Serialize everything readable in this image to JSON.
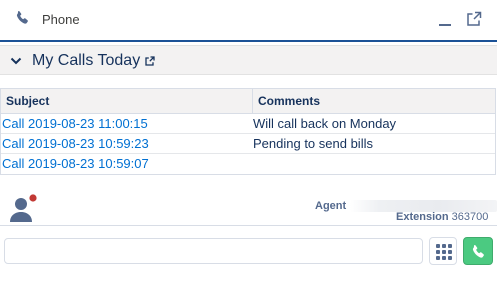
{
  "header": {
    "title": "Phone",
    "icon": "phone-icon",
    "minimize_icon": "minimize-icon",
    "popout_icon": "popout-icon",
    "accent_color": "#1b5297"
  },
  "section": {
    "title": "My Calls Today",
    "collapse_icon": "chevron-down-icon",
    "external_icon": "external-link-icon"
  },
  "table": {
    "columns": [
      "Subject",
      "Comments"
    ],
    "rows": [
      {
        "subject": "Call 2019-08-23 11:00:15",
        "comments": "Will call back on Monday"
      },
      {
        "subject": "Call 2019-08-23 10:59:23",
        "comments": "Pending to send bills"
      },
      {
        "subject": "Call 2019-08-23 10:59:07",
        "comments": ""
      }
    ],
    "link_color": "#0070d2"
  },
  "agent": {
    "label": "Agent",
    "extension_label": "Extension",
    "extension_value": "363700",
    "status_color": "#c23934",
    "avatar_icon": "user-avatar-icon"
  },
  "dial": {
    "input_value": "",
    "keypad_icon": "keypad-icon",
    "call_icon": "phone-call-icon",
    "call_color": "#4bca81"
  }
}
